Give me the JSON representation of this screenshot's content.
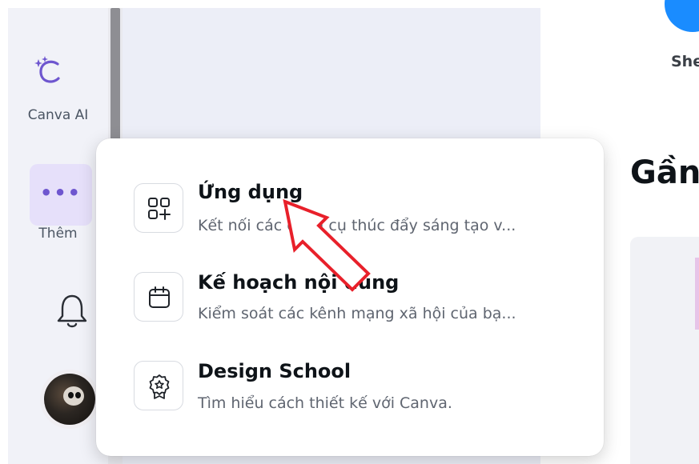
{
  "sidebar": {
    "canva_ai_label": "Canva AI",
    "more_label": "Thêm"
  },
  "header": {
    "profile_label": "She",
    "section_title": "Gần"
  },
  "menu": {
    "items": [
      {
        "title": "Ứng dụng",
        "description": "Kết nối các công cụ thúc đẩy sáng tạo v..."
      },
      {
        "title": "Kế hoạch nội dung",
        "description": "Kiểm soát các kênh mạng xã hội của bạ..."
      },
      {
        "title": "Design School",
        "description": "Tìm hiểu cách thiết kế với Canva."
      }
    ]
  },
  "colors": {
    "accent_purple": "#6e56cf",
    "more_button_bg": "#e6e0fa",
    "annotation_arrow": "#e8202a",
    "brand_blue": "#1a8cff"
  }
}
